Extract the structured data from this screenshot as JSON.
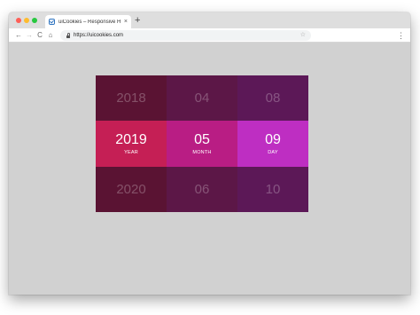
{
  "browser": {
    "tab_title": "uiCookies – Responsive HTML",
    "tab_close": "×",
    "new_tab": "+",
    "url": "https://uicookies.com",
    "nav": {
      "back": "←",
      "forward": "→",
      "reload": "C",
      "home": "⌂"
    },
    "star": "☆",
    "menu": "⋮"
  },
  "date_picker": {
    "columns": [
      {
        "label": "YEAR",
        "values": [
          "2018",
          "2019",
          "2020"
        ],
        "selected_index": 1,
        "colors": [
          "#5a1333",
          "#c51f55",
          "#5a1333"
        ]
      },
      {
        "label": "MONTH",
        "values": [
          "04",
          "05",
          "06"
        ],
        "selected_index": 1,
        "colors": [
          "#5c1747",
          "#b91d84",
          "#5c1747"
        ]
      },
      {
        "label": "DAY",
        "values": [
          "08",
          "09",
          "10"
        ],
        "selected_index": 1,
        "colors": [
          "#5c1857",
          "#be2ec2",
          "#5c1857"
        ]
      }
    ]
  }
}
